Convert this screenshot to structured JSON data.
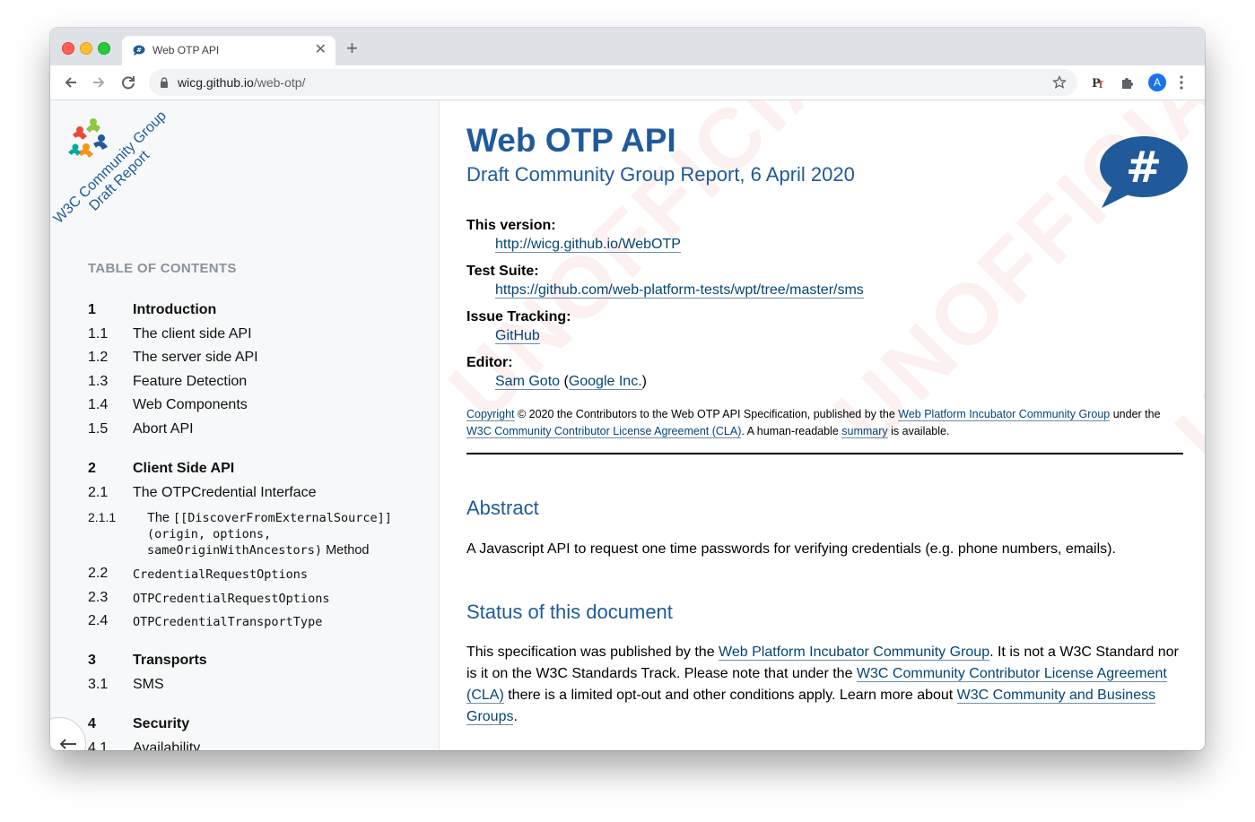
{
  "browser": {
    "tab_title": "Web OTP API",
    "new_tab": "+",
    "tab_close": "✕",
    "url_host": "wicg.github.io",
    "url_path": "/web-otp/",
    "avatar_letter": "A"
  },
  "logo": {
    "text_line1": "W3C Community Group",
    "text_line2": "Draft Report"
  },
  "toc": {
    "title": "TABLE OF CONTENTS",
    "items": [
      {
        "num": "1",
        "label": "Introduction"
      },
      {
        "num": "1.1",
        "label": "The client side API"
      },
      {
        "num": "1.2",
        "label": "The server side API"
      },
      {
        "num": "1.3",
        "label": "Feature Detection"
      },
      {
        "num": "1.4",
        "label": "Web Components"
      },
      {
        "num": "1.5",
        "label": "Abort API"
      },
      {
        "num": "2",
        "label": "Client Side API"
      },
      {
        "num": "2.1",
        "label": "The OTPCredential Interface"
      },
      {
        "num": "2.1.1",
        "label_prefix": "The ",
        "label_code1": "[[DiscoverFromExternalSource]]",
        "label_code2": "(origin, options,",
        "label_code3": "sameOriginWithAncestors)",
        "label_suffix": " Method"
      },
      {
        "num": "2.2",
        "label": "CredentialRequestOptions"
      },
      {
        "num": "2.3",
        "label": "OTPCredentialRequestOptions"
      },
      {
        "num": "2.4",
        "label": "OTPCredentialTransportType"
      },
      {
        "num": "3",
        "label": "Transports"
      },
      {
        "num": "3.1",
        "label": "SMS"
      },
      {
        "num": "4",
        "label": "Security"
      },
      {
        "num": "4.1",
        "label": "Availability"
      }
    ]
  },
  "doc": {
    "title": "Web OTP API",
    "subtitle": "Draft Community Group Report, 6 April 2020",
    "watermark1": "UNOFFICIAL DRAFT",
    "watermark2": "UNOFFICIAL DRAFT",
    "watermark3": "UN",
    "badge_symbol": "#",
    "this_version_label": "This version:",
    "this_version_url": "http://wicg.github.io/WebOTP",
    "test_suite_label": "Test Suite:",
    "test_suite_url": "https://github.com/web-platform-tests/wpt/tree/master/sms",
    "issue_label": "Issue Tracking:",
    "issue_link": "GitHub",
    "editor_label": "Editor:",
    "editor_name": "Sam Goto",
    "editor_org_open": " (",
    "editor_org": "Google Inc.",
    "editor_org_close": ")",
    "copyright_link": "Copyright",
    "copyright_text1": " © 2020 the Contributors to the Web OTP API Specification, published by the ",
    "copyright_group": "Web Platform Incubator Community Group",
    "copyright_text2": " under the ",
    "copyright_cla": "W3C Community Contributor License Agreement (CLA)",
    "copyright_text3": ". A human-readable ",
    "copyright_summary": "summary",
    "copyright_text4": " is available.",
    "abstract_heading": "Abstract",
    "abstract_text": "A Javascript API to request one time passwords for verifying credentials (e.g. phone numbers, emails).",
    "status_heading": "Status of this document",
    "status_text1": "This specification was published by the ",
    "status_link1": "Web Platform Incubator Community Group",
    "status_text2": ". It is not a W3C Standard nor is it on the W3C Standards Track. Please note that under the ",
    "status_link2": "W3C Community Contributor License Agreement (CLA)",
    "status_text3": " there is a limited opt-out and other conditions apply. Learn more about ",
    "status_link3": "W3C Community and Business Groups",
    "status_text4": "."
  }
}
